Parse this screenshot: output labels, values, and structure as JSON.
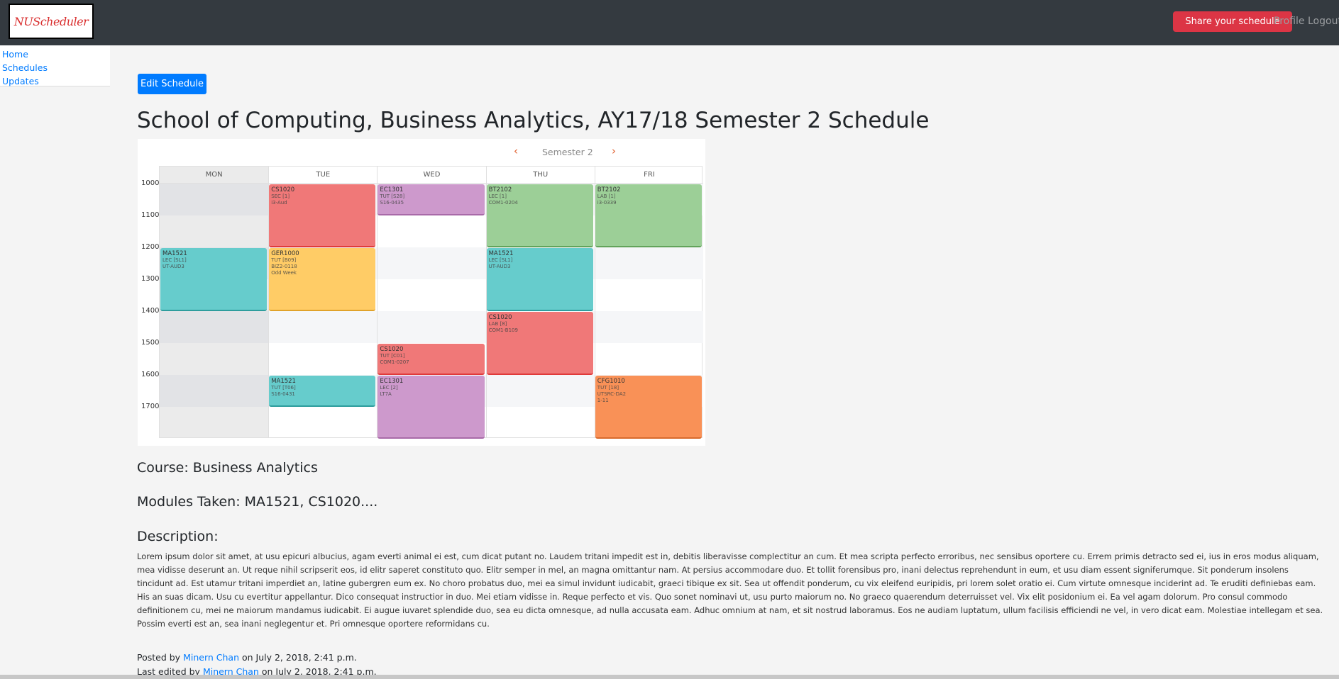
{
  "navbar": {
    "logo_text": "NUScheduler",
    "share_label": "Share your schedule",
    "profile_label": "Profile",
    "logout_label": "Logout"
  },
  "sidebar": {
    "items": [
      {
        "label": "Home"
      },
      {
        "label": "Schedules"
      },
      {
        "label": "Updates"
      }
    ]
  },
  "main": {
    "edit_button": "Edit Schedule",
    "title": "School of Computing, Business Analytics, AY17/18 Semester 2 Schedule",
    "course": "Course: Business Analytics",
    "modules": "Modules Taken: MA1521, CS1020....",
    "description_heading": "Description:",
    "description": "Lorem ipsum dolor sit amet, at usu epicuri albucius, agam everti animal ei est, cum dicat putant no. Laudem tritani impedit est in, debitis liberavisse complectitur an cum. Et mea scripta perfecto erroribus, nec sensibus oportere cu. Errem primis detracto sed ei, ius in eros modus aliquam, mea vidisse deserunt an. Ut reque nihil scripserit eos, id elitr saperet constituto quo. Elitr semper in mel, an magna omittantur nam. At persius accommodare duo. Et tollit forensibus pro, inani delectus reprehendunt in eum, et usu diam essent signiferumque. Sit ponderum insolens tincidunt ad. Est utamur tritani imperdiet an, latine gubergren eum ex. No choro probatus duo, mei ea simul invidunt iudicabit, graeci tibique ex sit. Sea ut offendit ponderum, cu vix eleifend euripidis, pri lorem solet oratio ei. Cum virtute omnesque inciderint ad. Te eruditi definiebas eam. His an suas dicam. Usu cu evertitur appellantur. Dico consequat instructior in duo. Mei etiam vidisse in. Reque perfecto et vis. Quo sonet nominavi ut, usu purto maiorum no. No graeco quaerendum deterruisset vel. Vix elit posidonium ei. Ea vel agam dolorum. Pro consul commodo definitionem cu, mei ne maiorum mandamus iudicabit. Ei augue iuvaret splendide duo, sea eu dicta omnesque, ad nulla accusata eam. Adhuc omnium at nam, et sit nostrud laboramus. Eos ne audiam luptatum, ullum facilisis efficiendi ne vel, in vero dicat eam. Molestiae intellegam et sea. Possim everti est an, sea inani neglegentur et. Pri omnesque oportere reformidans cu.",
    "posted_prefix": "Posted by",
    "posted_author": "Minern Chan",
    "posted_date": "on July 2, 2018, 2:41 p.m.",
    "edited_prefix": "Last edited by",
    "edited_author": "Minern Chan",
    "edited_date": "on July 2, 2018, 2:41 p.m."
  },
  "calendar": {
    "semester_label": "Semester 2",
    "prev_icon": "chevron-left",
    "next_icon": "chevron-right",
    "days": [
      "MON",
      "TUE",
      "WED",
      "THU",
      "FRI"
    ],
    "hours": [
      "1000",
      "1100",
      "1200",
      "1300",
      "1400",
      "1500",
      "1600",
      "1700"
    ],
    "colors": {
      "red": "#f07878",
      "red_border": "#e03a3a",
      "purple": "#cd99cc",
      "purple_border": "#a86aa8",
      "green": "#9ccf97",
      "green_border": "#62a35b",
      "teal": "#66cccc",
      "teal_border": "#2e9d9d",
      "yellow": "#ffcc66",
      "yellow_border": "#e0a22a",
      "orange": "#f99157",
      "orange_border": "#d86a2c"
    },
    "events": [
      {
        "day": 1,
        "start": 10,
        "end": 12,
        "color": "red",
        "code": "CS1020",
        "details": "SEC [1]\ni3-Aud"
      },
      {
        "day": 2,
        "start": 10,
        "end": 11,
        "color": "purple",
        "code": "EC1301",
        "details": "TUT [S28]\nS16-0435"
      },
      {
        "day": 3,
        "start": 10,
        "end": 12,
        "color": "green",
        "code": "BT2102",
        "details": "LEC [1]\nCOM1-0204"
      },
      {
        "day": 4,
        "start": 10,
        "end": 12,
        "color": "green",
        "code": "BT2102",
        "details": "LAB [1]\ni3-0339"
      },
      {
        "day": 0,
        "start": 12,
        "end": 14,
        "color": "teal",
        "code": "MA1521",
        "details": "LEC [SL1]\nUT-AUD3"
      },
      {
        "day": 1,
        "start": 12,
        "end": 14,
        "color": "yellow",
        "code": "GER1000",
        "details": "TUT [B09]\nBIZ2-0118\nOdd Week"
      },
      {
        "day": 3,
        "start": 12,
        "end": 14,
        "color": "teal",
        "code": "MA1521",
        "details": "LEC [SL1]\nUT-AUD3"
      },
      {
        "day": 3,
        "start": 14,
        "end": 16,
        "color": "red",
        "code": "CS1020",
        "details": "LAB [8]\nCOM1-B109"
      },
      {
        "day": 2,
        "start": 15,
        "end": 16,
        "color": "red",
        "code": "CS1020",
        "details": "TUT [C01]\nCOM1-0207"
      },
      {
        "day": 1,
        "start": 16,
        "end": 17,
        "color": "teal",
        "code": "MA1521",
        "details": "TUT [T06]\nS16-0431"
      },
      {
        "day": 2,
        "start": 16,
        "end": 18,
        "color": "purple",
        "code": "EC1301",
        "details": "LEC [2]\nLT7A"
      },
      {
        "day": 4,
        "start": 16,
        "end": 18,
        "color": "orange",
        "code": "CFG1010",
        "details": "TUT [18]\nUTSRC-DA2\n1-11"
      }
    ]
  }
}
